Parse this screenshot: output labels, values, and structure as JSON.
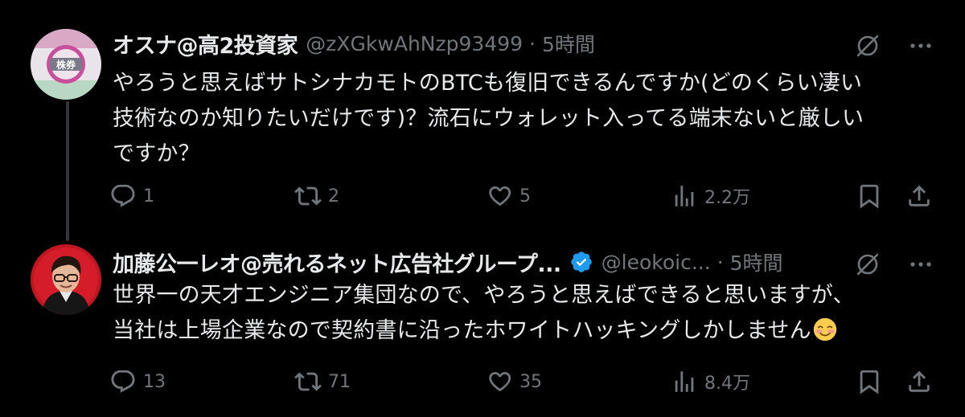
{
  "colors": {
    "background": "#000000",
    "text_primary": "#e7e9ea",
    "text_secondary": "#71767b",
    "verified_blue": "#1d9bf0",
    "thread_line": "#333639"
  },
  "tweets": [
    {
      "display_name": "オスナ@高2投資家",
      "handle": "@zXGkwAhNzp93499",
      "separator": "·",
      "time": "5時間",
      "avatar_icon": "stock-badge-avatar",
      "avatar_text": "株券",
      "verified": false,
      "body_lines": [
        "やろうと思えばサトシナカモトのBTCも復旧できるんですか(どのくらい凄い",
        "技術なのか知りたいだけです)？流石にウォレット入ってる端末ないと厳しい",
        "ですか？"
      ],
      "stats": {
        "replies": "1",
        "retweets": "2",
        "likes": "5",
        "views": "2.2万"
      }
    },
    {
      "display_name": "加藤公一レオ@売れるネット広告社グループ...",
      "handle": "@leokoic...",
      "separator": "·",
      "time": "5時間",
      "avatar_icon": "profile-photo-avatar",
      "verified": true,
      "body_lines": [
        "世界一の天才エンジニア集団なので、やろうと思えばできると思いますが、",
        "当社は上場企業なので契約書に沿ったホワイトハッキングしかしません"
      ],
      "emoji": "smiling-face-emoji",
      "stats": {
        "replies": "13",
        "retweets": "71",
        "likes": "35",
        "views": "8.4万"
      }
    }
  ]
}
